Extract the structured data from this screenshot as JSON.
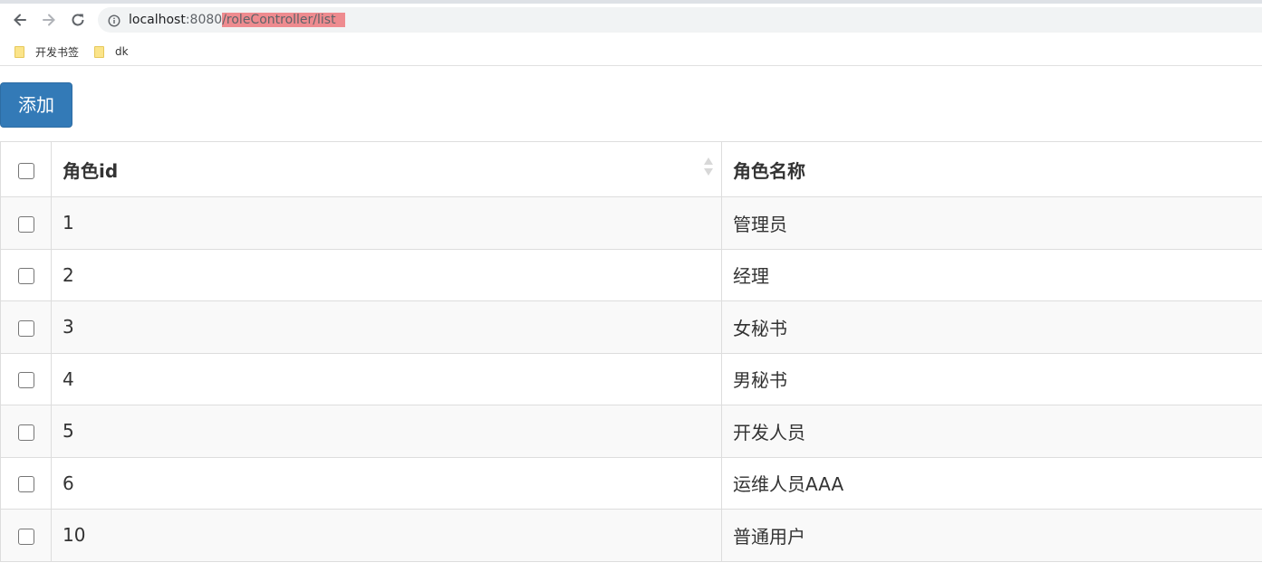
{
  "browser": {
    "url_host": "localhost",
    "url_port": ":8080",
    "url_path": "/roleController/list",
    "bookmarks": [
      {
        "label": "开发书签",
        "icon": "folder-icon"
      },
      {
        "label": "dk",
        "icon": "folder-icon"
      }
    ]
  },
  "toolbar": {
    "add_label": "添加"
  },
  "table": {
    "headers": {
      "id": "角色id",
      "name": "角色名称"
    },
    "rows": [
      {
        "id": "1",
        "name": "管理员"
      },
      {
        "id": "2",
        "name": "经理"
      },
      {
        "id": "3",
        "name": "女秘书"
      },
      {
        "id": "4",
        "name": "男秘书"
      },
      {
        "id": "5",
        "name": "开发人员"
      },
      {
        "id": "6",
        "name": "运维人员AAA"
      },
      {
        "id": "10",
        "name": "普通用户"
      }
    ]
  },
  "colors": {
    "primary": "#337ab7",
    "highlight": "#ee8b8f",
    "stripe": "#f9f9f9"
  }
}
